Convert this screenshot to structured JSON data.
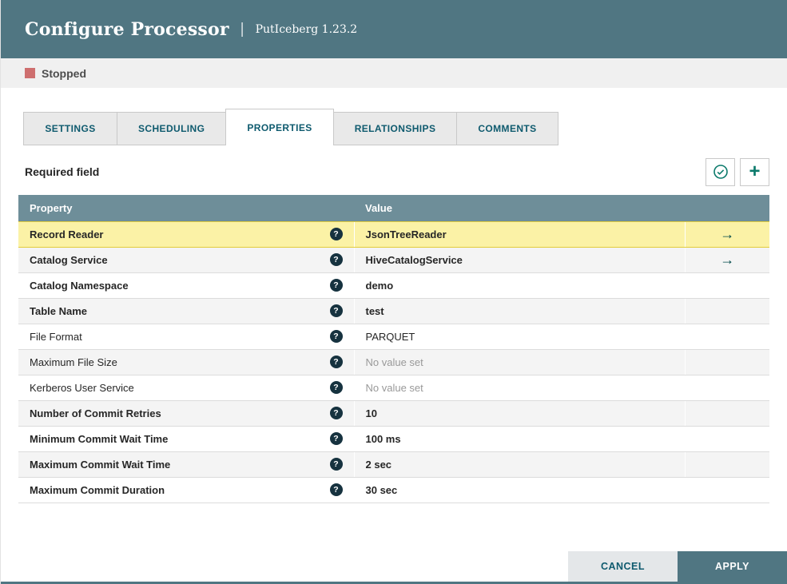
{
  "header": {
    "title": "Configure Processor",
    "separator": "|",
    "subtitle": "PutIceberg 1.23.2"
  },
  "status": {
    "label": "Stopped"
  },
  "tabs": [
    {
      "label": "SETTINGS"
    },
    {
      "label": "SCHEDULING"
    },
    {
      "label": "PROPERTIES"
    },
    {
      "label": "RELATIONSHIPS"
    },
    {
      "label": "COMMENTS"
    }
  ],
  "active_tab": "PROPERTIES",
  "toolbar": {
    "required_field_label": "Required field"
  },
  "icons": {
    "help": "?",
    "arrow": "→",
    "add": "+",
    "verify": "circle-check"
  },
  "table": {
    "columns": {
      "property": "Property",
      "value": "Value"
    },
    "rows": [
      {
        "property": "Record Reader",
        "value": "JsonTreeReader",
        "required": true,
        "highlighted": true,
        "has_help": true,
        "has_arrow": true
      },
      {
        "property": "Catalog Service",
        "value": "HiveCatalogService",
        "required": true,
        "highlighted": false,
        "has_help": true,
        "has_arrow": true
      },
      {
        "property": "Catalog Namespace",
        "value": "demo",
        "required": true,
        "highlighted": false,
        "has_help": true,
        "has_arrow": false
      },
      {
        "property": "Table Name",
        "value": "test",
        "required": true,
        "highlighted": false,
        "has_help": true,
        "has_arrow": false
      },
      {
        "property": "File Format",
        "value": "PARQUET",
        "required": false,
        "highlighted": false,
        "has_help": true,
        "has_arrow": false
      },
      {
        "property": "Maximum File Size",
        "value": "No value set",
        "required": false,
        "no_value": true,
        "highlighted": false,
        "has_help": true,
        "has_arrow": false
      },
      {
        "property": "Kerberos User Service",
        "value": "No value set",
        "required": false,
        "no_value": true,
        "highlighted": false,
        "has_help": true,
        "has_arrow": false
      },
      {
        "property": "Number of Commit Retries",
        "value": "10",
        "required": true,
        "highlighted": false,
        "has_help": true,
        "has_arrow": false
      },
      {
        "property": "Minimum Commit Wait Time",
        "value": "100 ms",
        "required": true,
        "highlighted": false,
        "has_help": true,
        "has_arrow": false
      },
      {
        "property": "Maximum Commit Wait Time",
        "value": "2 sec",
        "required": true,
        "highlighted": false,
        "has_help": true,
        "has_arrow": false
      },
      {
        "property": "Maximum Commit Duration",
        "value": "30 sec",
        "required": true,
        "highlighted": false,
        "has_help": true,
        "has_arrow": false
      }
    ]
  },
  "footer": {
    "cancel_label": "CANCEL",
    "apply_label": "APPLY"
  },
  "colors": {
    "header_bg": "#507682",
    "table_header_bg": "#6E8E99",
    "accent_teal": "#0E5A6E",
    "icon_teal": "#0B7A6B",
    "dark_teal": "#004849",
    "highlight_bg": "#FBF2A6",
    "highlight_border": "#E2CC3C",
    "stopped_red": "#CE6F6F",
    "status_bar_bg": "#F0F0F0",
    "row_alt_bg": "#F4F4F4",
    "apply_bg": "#507682",
    "cancel_bg": "#E4E7E9",
    "no_value_gray": "#999999"
  }
}
